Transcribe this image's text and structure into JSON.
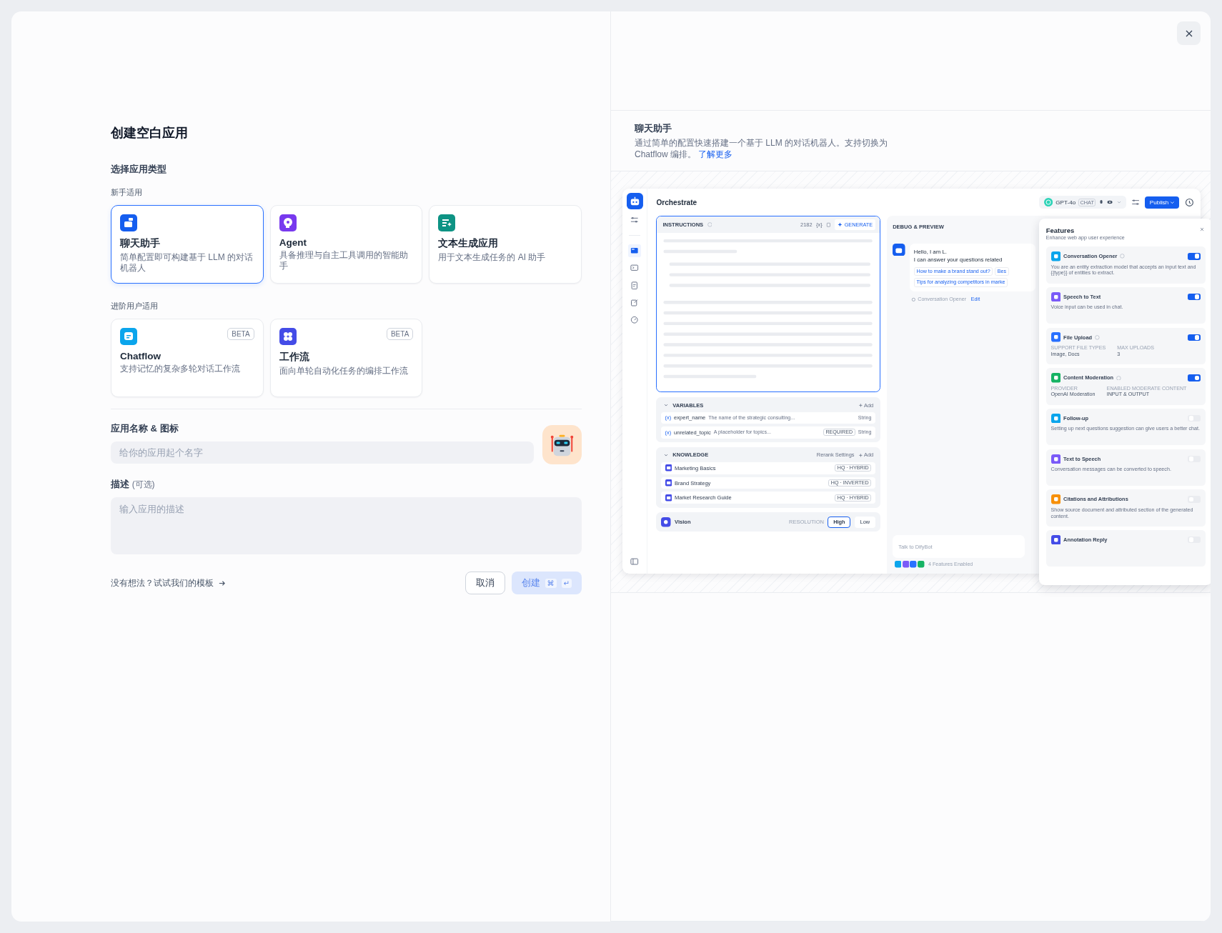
{
  "dialog": {
    "title": "创建空白应用",
    "section_label": "选择应用类型",
    "groups": [
      {
        "label": "新手适用",
        "types": [
          {
            "name": "聊天助手",
            "description": "简单配置即可构建基于 LLM 的对话机器人",
            "selected": true,
            "color": "#155eef"
          },
          {
            "name": "Agent",
            "description": "具备推理与自主工具调用的智能助手",
            "selected": false,
            "color": "#7839ee"
          },
          {
            "name": "文本生成应用",
            "description": "用于文本生成任务的 AI 助手",
            "selected": false,
            "color": "#0e9384"
          }
        ]
      },
      {
        "label": "进阶用户适用",
        "types": [
          {
            "name": "Chatflow",
            "description": "支持记忆的复杂多轮对话工作流",
            "selected": false,
            "color": "#0ba5ec",
            "badge": "BETA"
          },
          {
            "name": "工作流",
            "description": "面向单轮自动化任务的编排工作流",
            "selected": false,
            "color": "#444ce7",
            "badge": "BETA"
          }
        ]
      }
    ],
    "name_field": {
      "label": "应用名称 & 图标",
      "placeholder": "给你的应用起个名字"
    },
    "description_field": {
      "label": "描述",
      "optional": "(可选)",
      "placeholder": "输入应用的描述"
    },
    "template_link": "没有想法？试试我们的模板",
    "buttons": [
      {
        "label": "取消",
        "kind": "secondary",
        "disabled": false
      },
      {
        "label": "创建",
        "kind": "primary",
        "disabled": true,
        "shortcut": [
          "⌘",
          "↵"
        ]
      }
    ]
  },
  "preview": {
    "title": "聊天助手",
    "description": "通过简单的配置快速搭建一个基于 LLM 的对话机器人。支持切换为 Chatflow 编排。",
    "link": "了解更多",
    "app": {
      "title": "Orchestrate",
      "model": "GPT-4o",
      "model_tag": "CHAT",
      "publish": "Publish",
      "instructions": {
        "title": "INSTRUCTIONS",
        "count": "2182",
        "variable_marker": "{x}",
        "generate": "GENERATE"
      },
      "variables": {
        "title": "VARIABLES",
        "add": "Add",
        "items": [
          {
            "marker": "(x)",
            "name": "expert_name",
            "description": "The name of the strategic consulting...",
            "type": "String"
          },
          {
            "marker": "(x)",
            "name": "unrelated_topic",
            "description": "A placeholder for topics...",
            "badge": "REQUIRED",
            "type": "String"
          }
        ]
      },
      "knowledge": {
        "title": "KNOWLEDGE",
        "rerank": "Rerank Settings",
        "add": "Add",
        "items": [
          {
            "name": "Marketing Basics",
            "tag": "HQ · HYBRID"
          },
          {
            "name": "Brand Strategy",
            "tag": "HQ · INVERTED"
          },
          {
            "name": "Market Research Guide",
            "tag": "HQ · HYBRID"
          }
        ]
      },
      "vision": {
        "title": "Vision",
        "resolution_label": "RESOLUTION",
        "options": [
          {
            "label": "High",
            "selected": true
          },
          {
            "label": "Low",
            "selected": false
          }
        ]
      },
      "debug": {
        "title": "DEBUG & PREVIEW",
        "greeting": "Hello, I am L.",
        "message": "I can answer your questions related",
        "suggestions": [
          "How to make a brand stand out?",
          "Bes",
          "Tips for analyzing competitors in marke"
        ],
        "opener_note": "Conversation Opener",
        "opener_edit": "Edit",
        "input_placeholder": "Talk to DifyBot",
        "features_enabled": "4 Features Enabled"
      },
      "features": {
        "title": "Features",
        "subtitle": "Enhance web app user experience",
        "items": [
          {
            "name": "Conversation Opener",
            "help": true,
            "on": true,
            "color": "#0ba5ec",
            "description": "You are an entity extraction model that accepts an input text and {{type}} of entities to extract."
          },
          {
            "name": "Speech to Text",
            "help": false,
            "on": true,
            "color": "#7a5af8",
            "description": "Voice input can be used in chat."
          },
          {
            "name": "File Upload",
            "help": true,
            "on": true,
            "color": "#2970ff",
            "details": [
              {
                "label": "SUPPORT FILE TYPES",
                "value": "Image, Docs"
              },
              {
                "label": "MAX UPLOADS",
                "value": "3"
              }
            ]
          },
          {
            "name": "Content Moderation",
            "help": true,
            "on": true,
            "color": "#16b364",
            "details": [
              {
                "label": "PROVIDER",
                "value": "OpenAI Moderation"
              },
              {
                "label": "ENABLED MODERATE CONTENT",
                "value": "INPUT & OUTPUT"
              }
            ]
          },
          {
            "name": "Follow-up",
            "help": false,
            "on": false,
            "color": "#0ba5ec",
            "description": "Setting up next questions suggestion can give users a better chat."
          },
          {
            "name": "Text to Speech",
            "help": false,
            "on": false,
            "color": "#7a5af8",
            "description": "Conversation messages can be converted to speech."
          },
          {
            "name": "Citations and Attributions",
            "help": false,
            "on": false,
            "color": "#f79009",
            "description": "Show source document and attributed section of the generated content."
          },
          {
            "name": "Annotation Reply",
            "help": false,
            "on": false,
            "color": "#444ce7"
          }
        ]
      }
    }
  }
}
